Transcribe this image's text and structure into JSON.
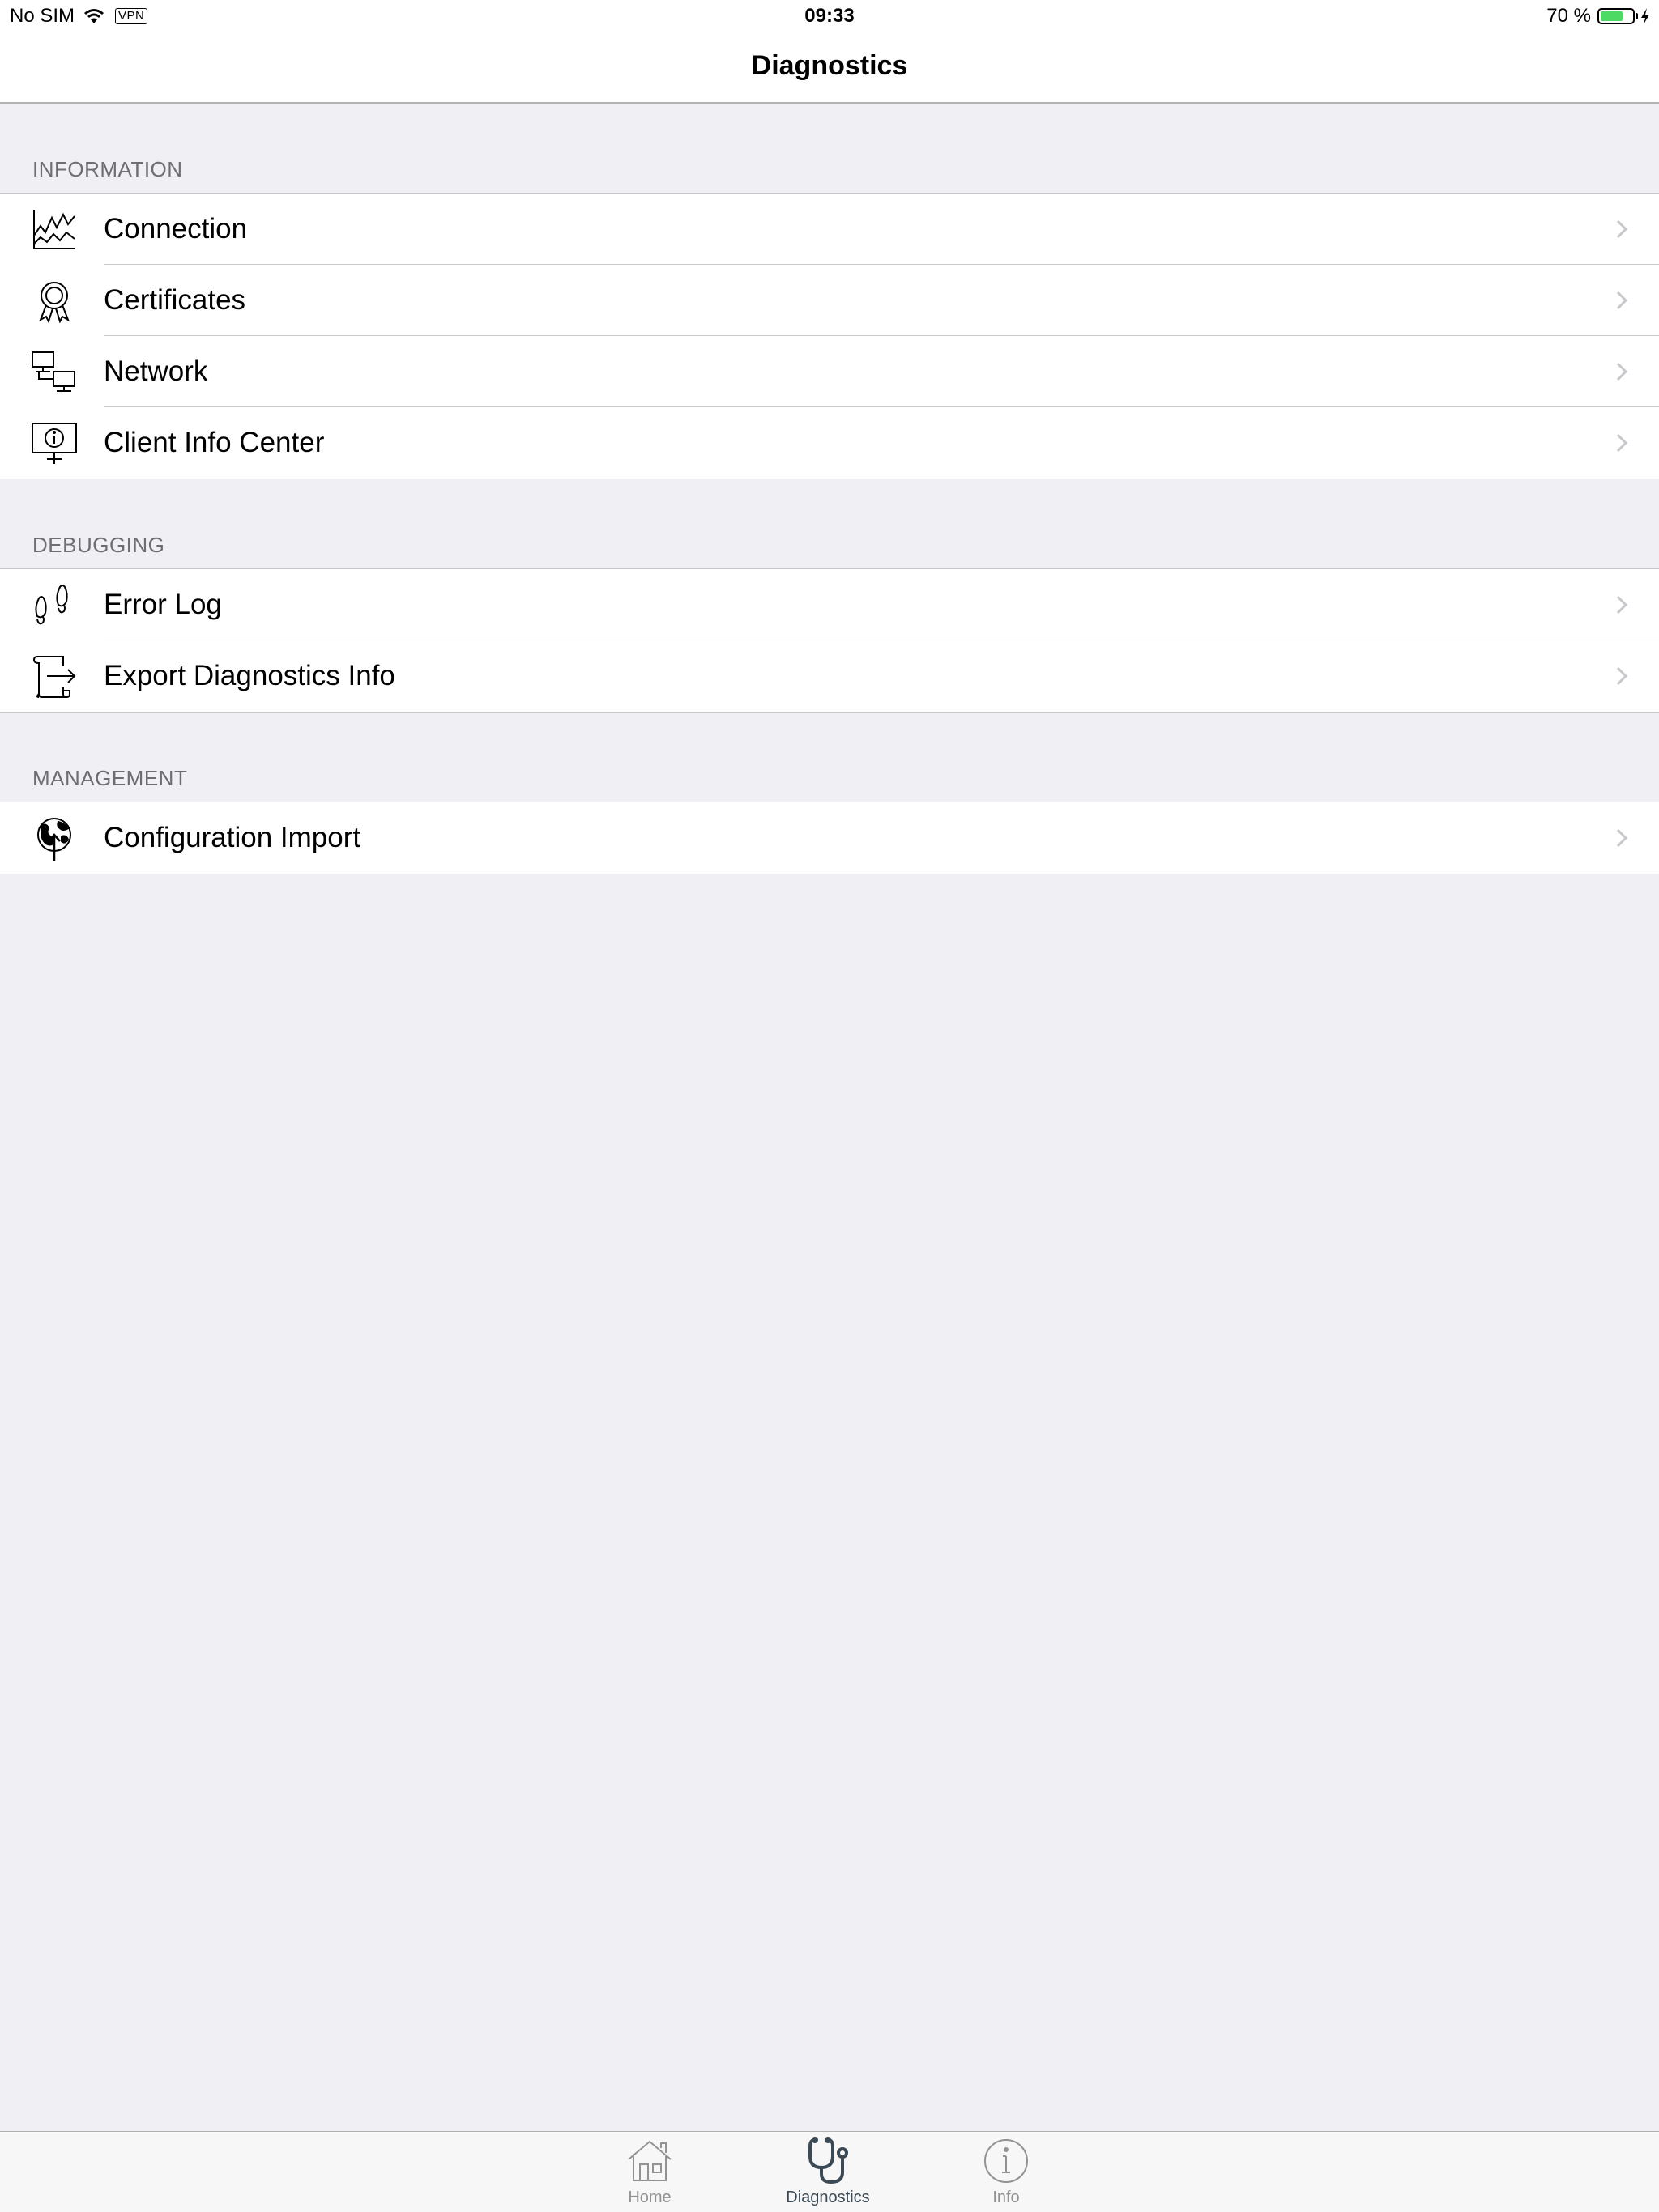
{
  "status_bar": {
    "carrier": "No SIM",
    "vpn": "VPN",
    "time": "09:33",
    "battery_text": "70 %",
    "battery_level": 0.7,
    "battery_color": "#4cd964"
  },
  "nav": {
    "title": "Diagnostics"
  },
  "sections": {
    "information": {
      "header": "INFORMATION",
      "items": [
        {
          "label": "Connection",
          "icon": "line-chart-icon"
        },
        {
          "label": "Certificates",
          "icon": "certificate-ribbon-icon"
        },
        {
          "label": "Network",
          "icon": "network-computers-icon"
        },
        {
          "label": "Client Info Center",
          "icon": "monitor-info-icon"
        }
      ]
    },
    "debugging": {
      "header": "DEBUGGING",
      "items": [
        {
          "label": "Error Log",
          "icon": "footprints-icon"
        },
        {
          "label": "Export Diagnostics Info",
          "icon": "scroll-export-icon"
        }
      ]
    },
    "management": {
      "header": "MANAGEMENT",
      "items": [
        {
          "label": "Configuration Import",
          "icon": "globe-import-icon"
        }
      ]
    }
  },
  "tab_bar": {
    "tabs": [
      {
        "label": "Home",
        "icon": "home-icon",
        "active": false
      },
      {
        "label": "Diagnostics",
        "icon": "stethoscope-icon",
        "active": true
      },
      {
        "label": "Info",
        "icon": "info-circle-icon",
        "active": false
      }
    ],
    "active_color": "#3b4a55",
    "inactive_color": "#929292"
  },
  "colors": {
    "background": "#efeff4",
    "section_header": "#6d6d72",
    "separator": "#c8c7cc",
    "chevron": "#c7c7cc"
  }
}
